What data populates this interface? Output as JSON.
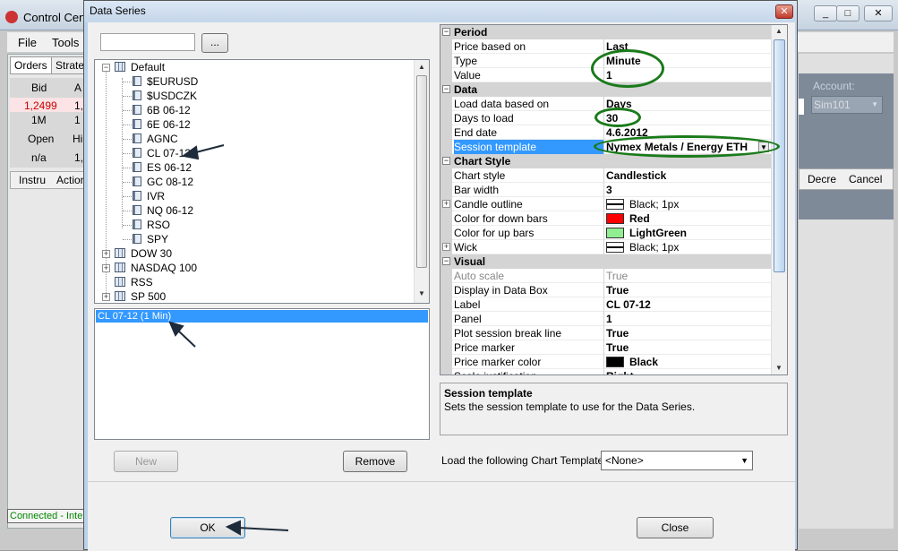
{
  "background": {
    "title": "Control Cen",
    "menu": [
      "File",
      "Tools"
    ],
    "tabs": [
      "Orders",
      "Strateg"
    ],
    "cells": [
      "Bid",
      "A",
      "1,2499",
      "1,",
      "1M",
      "1",
      "Open",
      "Hi",
      "n/a",
      "1,",
      "Instru",
      "Action"
    ],
    "right_labels": [
      "Account:",
      "Sim101",
      "Decre",
      "Cancel"
    ],
    "status": "Connected - Inte",
    "window_controls": [
      "_",
      "□",
      "✕"
    ]
  },
  "dialog": {
    "title": "Data Series",
    "close": "✕",
    "browse_label": "...",
    "search_value": "",
    "tree": {
      "root": "Default",
      "items": [
        "$EURUSD",
        "$USDCZK",
        "6B 06-12",
        "6E 06-12",
        "AGNC",
        "CL 07-12",
        "ES 06-12",
        "GC 08-12",
        "IVR",
        "NQ 06-12",
        "RSO",
        "SPY"
      ],
      "groups": [
        "DOW 30",
        "NASDAQ 100",
        "RSS",
        "SP 500"
      ]
    },
    "selected_series": "CL 07-12 (1 Min)",
    "new_label": "New",
    "remove_label": "Remove",
    "ok_label": "OK",
    "close_label": "Close",
    "template_label": "Load the following Chart Template:",
    "template_value": "<None>",
    "properties": {
      "period": {
        "name": "Period",
        "rows": [
          {
            "n": "Price based on",
            "v": "Last"
          },
          {
            "n": "Type",
            "v": "Minute"
          },
          {
            "n": "Value",
            "v": "1"
          }
        ]
      },
      "data": {
        "name": "Data",
        "rows": [
          {
            "n": "Load data based on",
            "v": "Days"
          },
          {
            "n": "Days to load",
            "v": "30"
          },
          {
            "n": "End date",
            "v": "4.6.2012"
          },
          {
            "n": "Session template",
            "v": "Nymex Metals / Energy ETH"
          }
        ]
      },
      "chart_style": {
        "name": "Chart Style",
        "rows": [
          {
            "n": "Chart style",
            "v": "Candlestick"
          },
          {
            "n": "Bar width",
            "v": "3"
          },
          {
            "n": "Candle outline",
            "v": "Black; 1px"
          },
          {
            "n": "Color for down bars",
            "v": "Red"
          },
          {
            "n": "Color for up bars",
            "v": "LightGreen"
          },
          {
            "n": "Wick",
            "v": "Black; 1px"
          }
        ]
      },
      "visual": {
        "name": "Visual",
        "rows": [
          {
            "n": "Auto scale",
            "v": "True"
          },
          {
            "n": "Display in Data Box",
            "v": "True"
          },
          {
            "n": "Label",
            "v": "CL 07-12"
          },
          {
            "n": "Panel",
            "v": "1"
          },
          {
            "n": "Plot session break line",
            "v": "True"
          },
          {
            "n": "Price marker",
            "v": "True"
          },
          {
            "n": "Price marker color",
            "v": "Black"
          },
          {
            "n": "Scale justification",
            "v": "Right"
          }
        ]
      }
    },
    "description": {
      "title": "Session template",
      "text": "Sets the session template to use for the Data Series."
    },
    "colors": {
      "red": "#ff0000",
      "lightgreen": "#90ee90",
      "black": "#000000",
      "highlight": "#3399ff",
      "annotation": "#1a7a1a"
    }
  }
}
